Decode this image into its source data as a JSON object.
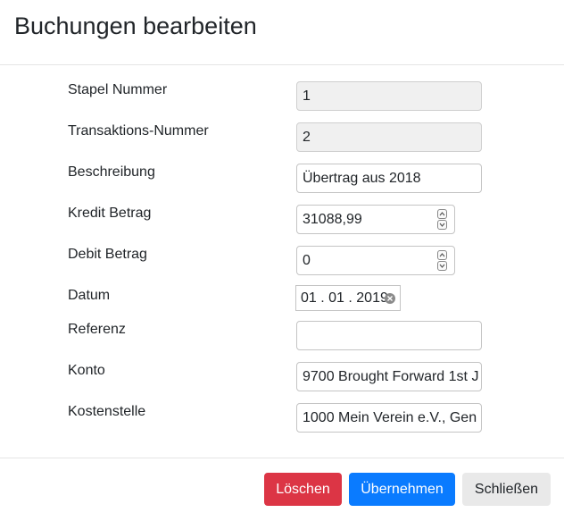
{
  "modal": {
    "title": "Buchungen bearbeiten"
  },
  "form": {
    "batch_number": {
      "label": "Stapel Nummer",
      "value": "1"
    },
    "transaction_number": {
      "label": "Transaktions-Nummer",
      "value": "2"
    },
    "description": {
      "label": "Beschreibung",
      "value": "Übertrag aus 2018"
    },
    "credit_amount": {
      "label": "Kredit Betrag",
      "value": "31088,99"
    },
    "debit_amount": {
      "label": "Debit Betrag",
      "value": "0"
    },
    "date": {
      "label": "Datum",
      "value": "01 . 01 . 2019"
    },
    "reference": {
      "label": "Referenz",
      "value": ""
    },
    "account": {
      "label": "Konto",
      "value": "9700 Brought Forward 1st J"
    },
    "cost_center": {
      "label": "Kostenstelle",
      "value": "1000 Mein Verein e.V., Gen"
    }
  },
  "footer": {
    "delete_label": "Löschen",
    "apply_label": "Übernehmen",
    "close_label": "Schließen"
  },
  "colors": {
    "delete": "#dc3545",
    "apply": "#0a7bff",
    "close": "#e9e9e9"
  }
}
